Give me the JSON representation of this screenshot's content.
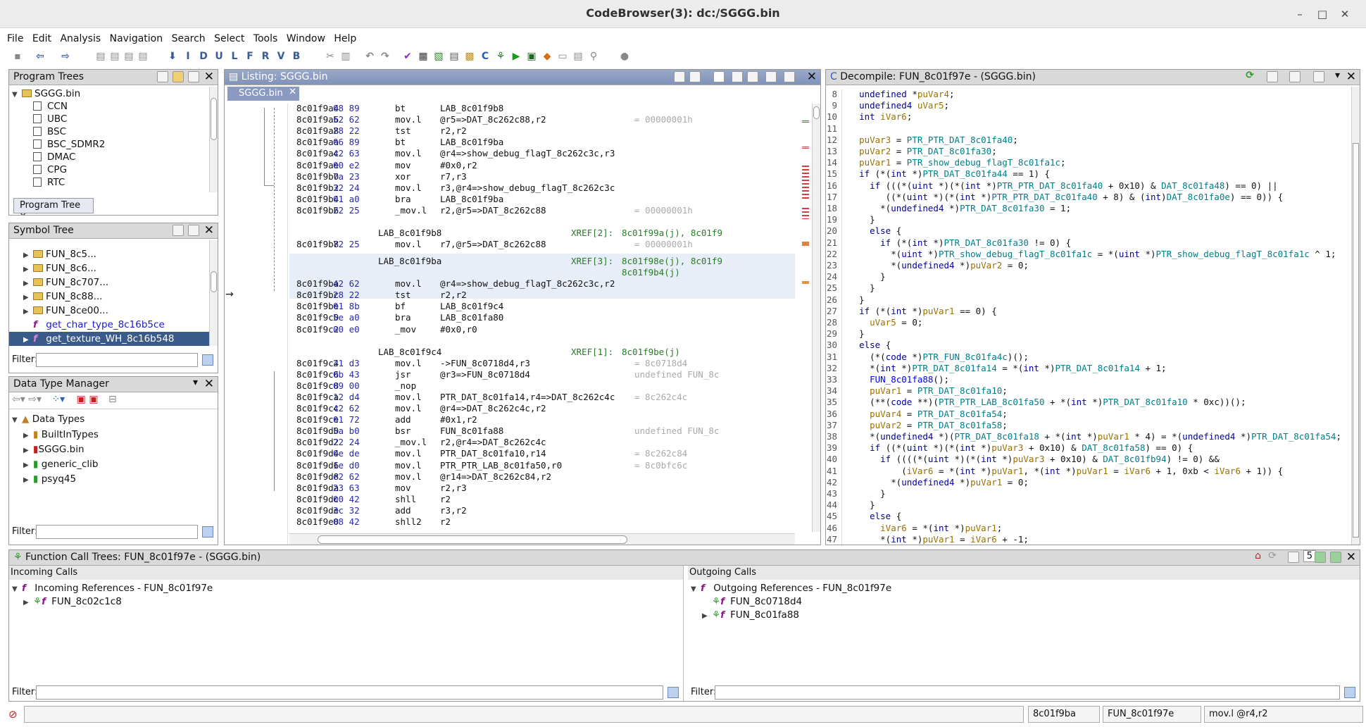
{
  "window": {
    "title": "CodeBrowser(3): dc:/SGGG.bin"
  },
  "menu": [
    "File",
    "Edit",
    "Analysis",
    "Navigation",
    "Search",
    "Select",
    "Tools",
    "Window",
    "Help"
  ],
  "toolbar_letters": [
    "I",
    "D",
    "U",
    "L",
    "F",
    "R",
    "V",
    "B"
  ],
  "program_trees": {
    "title": "Program Trees",
    "root": "SGGG.bin",
    "items": [
      "CCN",
      "UBC",
      "BSC",
      "BSC_SDMR2",
      "DMAC",
      "CPG",
      "RTC"
    ],
    "tab": "Program Tree"
  },
  "symbol_tree": {
    "title": "Symbol Tree",
    "items": [
      "FUN_8c5...",
      "FUN_8c6...",
      "FUN_8c707...",
      "FUN_8c88...",
      "FUN_8ce00..."
    ],
    "functions": [
      "get_char_type_8c16b5ce",
      "get_texture_WH_8c16b548"
    ],
    "filter_label": "Filter:"
  },
  "dtm": {
    "title": "Data Type Manager",
    "root": "Data Types",
    "items": [
      "BuiltInTypes",
      "SGGG.bin",
      "generic_clib",
      "psyq45"
    ],
    "filter_label": "Filter:"
  },
  "listing": {
    "title": "Listing:  SGGG.bin",
    "tab": "SGGG.bin",
    "rows": [
      {
        "a": "8c01f9a4",
        "b": "08 89",
        "m": "bt",
        "o": "LAB_8c01f9b8",
        "c": ""
      },
      {
        "a": "8c01f9a6",
        "b": "52 62",
        "m": "mov.l",
        "o": "@r5=>DAT_8c262c88,r2",
        "c": "= 00000001h"
      },
      {
        "a": "8c01f9a8",
        "b": "28 22",
        "m": "tst",
        "o": "r2,r2",
        "c": ""
      },
      {
        "a": "8c01f9aa",
        "b": "06 89",
        "m": "bt",
        "o": "LAB_8c01f9ba",
        "c": ""
      },
      {
        "a": "8c01f9ac",
        "b": "42 63",
        "m": "mov.l",
        "o": "@r4=>show_debug_flagT_8c262c3c,r3",
        "c": ""
      },
      {
        "a": "8c01f9ae",
        "b": "00 e2",
        "m": "mov",
        "o": "#0x0,r2",
        "c": ""
      },
      {
        "a": "8c01f9b0",
        "b": "7a 23",
        "m": "xor",
        "o": "r7,r3",
        "c": ""
      },
      {
        "a": "8c01f9b2",
        "b": "32 24",
        "m": "mov.l",
        "o": "r3,@r4=>show_debug_flagT_8c262c3c",
        "c": ""
      },
      {
        "a": "8c01f9b4",
        "b": "01 a0",
        "m": "bra",
        "o": "LAB_8c01f9ba",
        "c": ""
      },
      {
        "a": "8c01f9b6",
        "b": "22 25",
        "m": "_mov.l",
        "o": "r2,@r5=>DAT_8c262c88",
        "c": "= 00000001h"
      }
    ],
    "lab1": {
      "name": "LAB_8c01f9b8",
      "xref": "XREF[2]:",
      "xv": "8c01f99a(j), 8c01f9"
    },
    "rows2": [
      {
        "a": "8c01f9b8",
        "b": "72 25",
        "m": "mov.l",
        "o": "r7,@r5=>DAT_8c262c88",
        "c": "= 00000001h"
      }
    ],
    "lab2": {
      "name": "LAB_8c01f9ba",
      "xref": "XREF[3]:",
      "xv": "8c01f98e(j), 8c01f9",
      "xv2": "8c01f9b4(j)"
    },
    "rows3": [
      {
        "a": "8c01f9ba",
        "b": "42 62",
        "m": "mov.l",
        "o": "@r4=>show_debug_flagT_8c262c3c,r2",
        "c": ""
      },
      {
        "a": "8c01f9bc",
        "b": "28 22",
        "m": "tst",
        "o": "r2,r2",
        "c": ""
      },
      {
        "a": "8c01f9be",
        "b": "01 8b",
        "m": "bf",
        "o": "LAB_8c01f9c4",
        "c": ""
      },
      {
        "a": "8c01f9c0",
        "b": "5e a0",
        "m": "bra",
        "o": "LAB_8c01fa80",
        "c": ""
      },
      {
        "a": "8c01f9c2",
        "b": "00 e0",
        "m": "_mov",
        "o": "#0x0,r0",
        "c": ""
      }
    ],
    "lab3": {
      "name": "LAB_8c01f9c4",
      "xref": "XREF[1]:",
      "xv": "8c01f9be(j)"
    },
    "rows4": [
      {
        "a": "8c01f9c4",
        "b": "21 d3",
        "m": "mov.l",
        "o": "->FUN_8c0718d4,r3",
        "c": "= 8c0718d4"
      },
      {
        "a": "8c01f9c6",
        "b": "0b 43",
        "m": "jsr",
        "o": "@r3=>FUN_8c0718d4",
        "c": "undefined FUN_8c"
      },
      {
        "a": "8c01f9c8",
        "b": "09 00",
        "m": "_nop",
        "o": "",
        "c": ""
      },
      {
        "a": "8c01f9ca",
        "b": "12 d4",
        "m": "mov.l",
        "o": "PTR_DAT_8c01fa14,r4=>DAT_8c262c4c",
        "c": "= 8c262c4c"
      },
      {
        "a": "8c01f9cc",
        "b": "42 62",
        "m": "mov.l",
        "o": "@r4=>DAT_8c262c4c,r2",
        "c": ""
      },
      {
        "a": "8c01f9ce",
        "b": "01 72",
        "m": "add",
        "o": "#0x1,r2",
        "c": ""
      },
      {
        "a": "8c01f9d0",
        "b": "5a b0",
        "m": "bsr",
        "o": "FUN_8c01fa88",
        "c": "undefined FUN_8c"
      },
      {
        "a": "8c01f9d2",
        "b": "22 24",
        "m": "_mov.l",
        "o": "r2,@r4=>DAT_8c262c4c",
        "c": ""
      },
      {
        "a": "8c01f9d4",
        "b": "0e de",
        "m": "mov.l",
        "o": "PTR_DAT_8c01fa10,r14",
        "c": "= 8c262c84"
      },
      {
        "a": "8c01f9d6",
        "b": "1e d0",
        "m": "mov.l",
        "o": "PTR_PTR_LAB_8c01fa50,r0",
        "c": "= 8c0bfc6c"
      },
      {
        "a": "8c01f9d8",
        "b": "e2 62",
        "m": "mov.l",
        "o": "@r14=>DAT_8c262c84,r2",
        "c": ""
      },
      {
        "a": "8c01f9da",
        "b": "23 63",
        "m": "mov",
        "o": "r2,r3",
        "c": ""
      },
      {
        "a": "8c01f9dc",
        "b": "00 42",
        "m": "shll",
        "o": "r2",
        "c": ""
      },
      {
        "a": "8c01f9de",
        "b": "3c 32",
        "m": "add",
        "o": "r3,r2",
        "c": ""
      },
      {
        "a": "8c01f9e0",
        "b": "08 42",
        "m": "shll2",
        "o": "r2",
        "c": ""
      }
    ]
  },
  "decompile": {
    "title": "Decompile: FUN_8c01f97e -  (SGGG.bin)",
    "lines": [
      {
        "n": "8",
        "t": "  undefined *puVar4;"
      },
      {
        "n": "9",
        "t": "  undefined4 uVar5;"
      },
      {
        "n": "10",
        "t": "  int iVar6;"
      },
      {
        "n": "11",
        "t": ""
      },
      {
        "n": "12",
        "t": "  puVar3 = PTR_PTR_DAT_8c01fa40;"
      },
      {
        "n": "13",
        "t": "  puVar2 = PTR_DAT_8c01fa30;"
      },
      {
        "n": "14",
        "t": "  puVar1 = PTR_show_debug_flagT_8c01fa1c;"
      },
      {
        "n": "15",
        "t": "  if (*(int *)PTR_DAT_8c01fa44 == 1) {"
      },
      {
        "n": "16",
        "t": "    if (((*(uint *)(*(int *)PTR_PTR_DAT_8c01fa40 + 0x10) & DAT_8c01fa48) == 0) ||"
      },
      {
        "n": "17",
        "t": "       ((*(uint *)(*(int *)PTR_PTR_DAT_8c01fa40 + 8) & (int)DAT_8c01fa0e) == 0)) {"
      },
      {
        "n": "18",
        "t": "      *(undefined4 *)PTR_DAT_8c01fa30 = 1;"
      },
      {
        "n": "19",
        "t": "    }"
      },
      {
        "n": "20",
        "t": "    else {"
      },
      {
        "n": "21",
        "t": "      if (*(int *)PTR_DAT_8c01fa30 != 0) {"
      },
      {
        "n": "22",
        "t": "        *(uint *)PTR_show_debug_flagT_8c01fa1c = *(uint *)PTR_show_debug_flagT_8c01fa1c ^ 1;"
      },
      {
        "n": "23",
        "t": "        *(undefined4 *)puVar2 = 0;"
      },
      {
        "n": "24",
        "t": "      }"
      },
      {
        "n": "25",
        "t": "    }"
      },
      {
        "n": "26",
        "t": "  }"
      },
      {
        "n": "27",
        "t": "  if (*(int *)puVar1 == 0) {"
      },
      {
        "n": "28",
        "t": "    uVar5 = 0;"
      },
      {
        "n": "29",
        "t": "  }"
      },
      {
        "n": "30",
        "t": "  else {"
      },
      {
        "n": "31",
        "t": "    (*(code *)PTR_FUN_8c01fa4c)();"
      },
      {
        "n": "32",
        "t": "    *(int *)PTR_DAT_8c01fa14 = *(int *)PTR_DAT_8c01fa14 + 1;"
      },
      {
        "n": "33",
        "t": "    FUN_8c01fa88();"
      },
      {
        "n": "34",
        "t": "    puVar1 = PTR_DAT_8c01fa10;"
      },
      {
        "n": "35",
        "t": "    (**(code **)(PTR_PTR_LAB_8c01fa50 + *(int *)PTR_DAT_8c01fa10 * 0xc))();"
      },
      {
        "n": "36",
        "t": "    puVar4 = PTR_DAT_8c01fa54;"
      },
      {
        "n": "37",
        "t": "    puVar2 = PTR_DAT_8c01fa58;"
      },
      {
        "n": "38",
        "t": "    *(undefined4 *)(PTR_DAT_8c01fa18 + *(int *)puVar1 * 4) = *(undefined4 *)PTR_DAT_8c01fa54;"
      },
      {
        "n": "39",
        "t": "    if ((*(uint *)(*(int *)puVar3 + 0x10) & DAT_8c01fa58) == 0) {"
      },
      {
        "n": "40",
        "t": "      if ((((*(uint *)(*(int *)puVar3 + 0x10) & DAT_8c01fb94) != 0) &&"
      },
      {
        "n": "41",
        "t": "          (iVar6 = *(int *)puVar1, *(int *)puVar1 = iVar6 + 1, 0xb < iVar6 + 1)) {"
      },
      {
        "n": "42",
        "t": "        *(undefined4 *)puVar1 = 0;"
      },
      {
        "n": "43",
        "t": "      }"
      },
      {
        "n": "44",
        "t": "    }"
      },
      {
        "n": "45",
        "t": "    else {"
      },
      {
        "n": "46",
        "t": "      iVar6 = *(int *)puVar1;"
      },
      {
        "n": "47",
        "t": "      *(int *)puVar1 = iVar6 + -1;"
      }
    ]
  },
  "calltrees": {
    "title": "Function Call Trees: FUN_8c01f97e -  (SGGG.bin)",
    "count": "5",
    "incoming_label": "Incoming Calls",
    "incoming_root": "Incoming References - FUN_8c01f97e",
    "incoming_items": [
      "FUN_8c02c1c8"
    ],
    "outgoing_label": "Outgoing Calls",
    "outgoing_root": "Outgoing References - FUN_8c01f97e",
    "outgoing_items": [
      "FUN_8c0718d4",
      "FUN_8c01fa88"
    ],
    "filter_label": "Filter:"
  },
  "status": {
    "addr": "8c01f9ba",
    "func": "FUN_8c01f97e",
    "instr": "mov.l @r4,r2"
  }
}
